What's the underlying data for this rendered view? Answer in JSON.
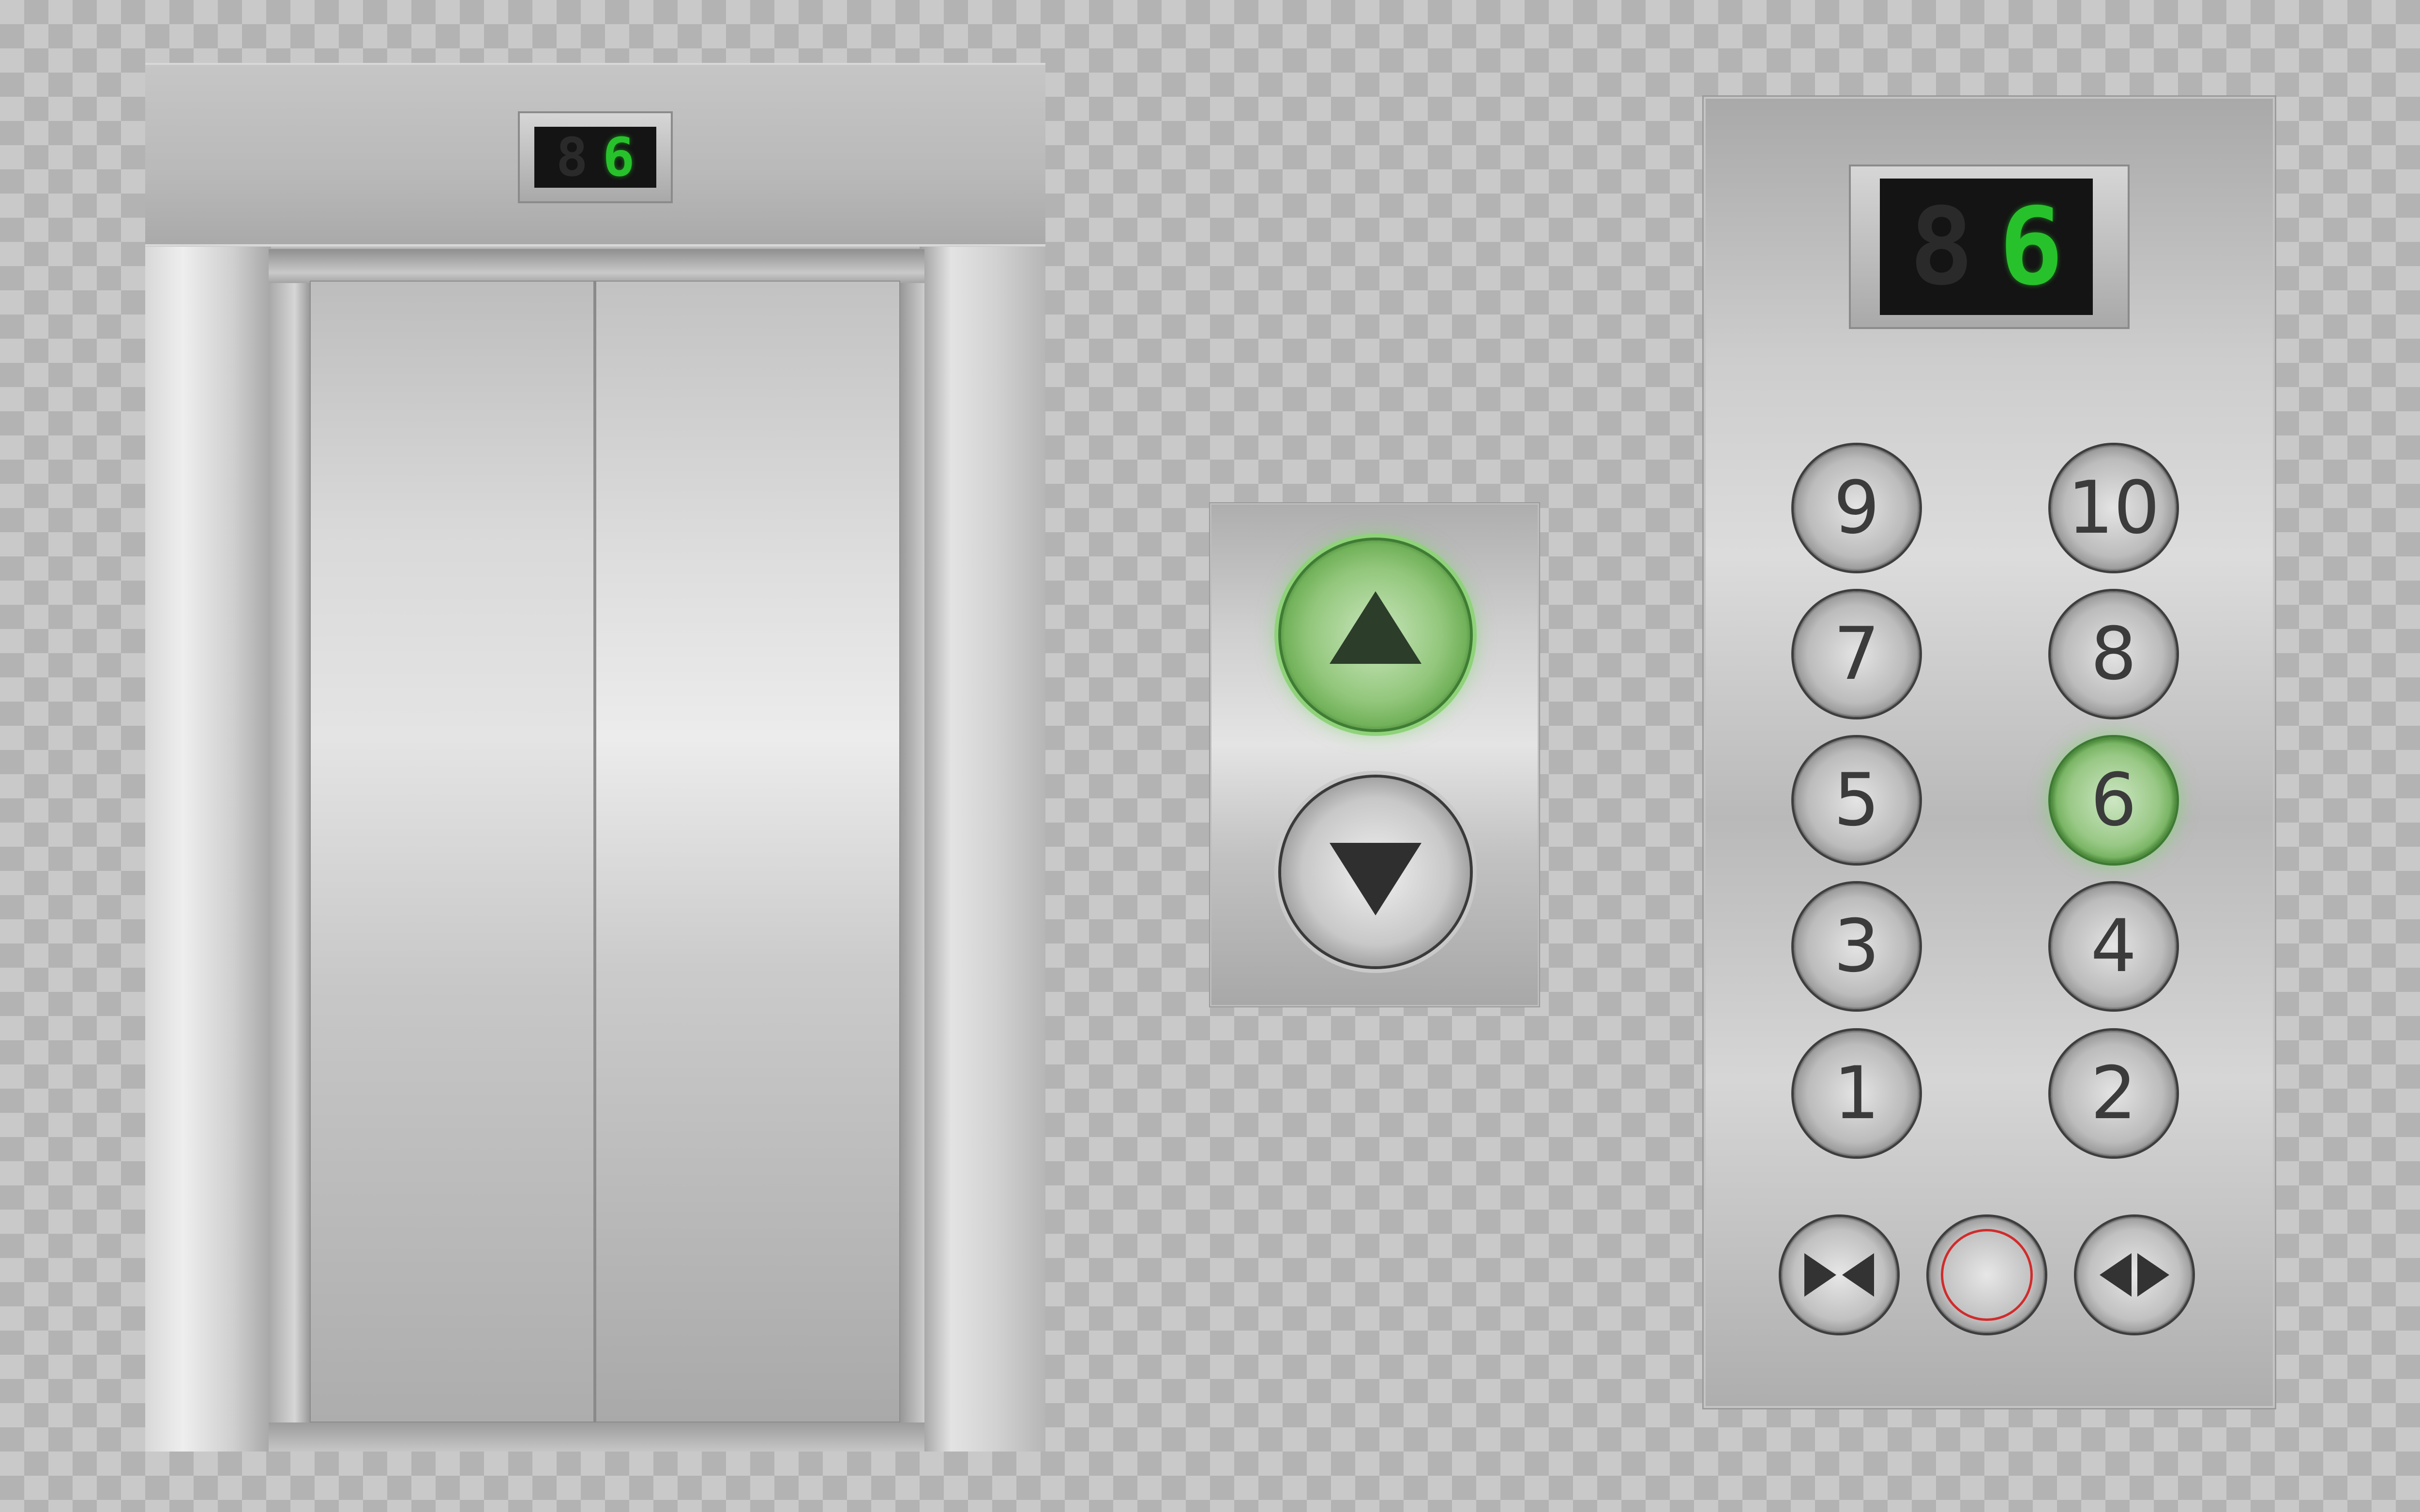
{
  "door_unit": {
    "display": {
      "dim_digit": "8",
      "lit_digit": "6"
    }
  },
  "call_panel": {
    "up": {
      "icon": "arrow-up-icon",
      "state": "lit"
    },
    "down": {
      "icon": "arrow-down-icon",
      "state": "off"
    }
  },
  "car_panel": {
    "display": {
      "dim_digit": "8",
      "lit_digit": "6"
    },
    "floor_buttons": [
      "9",
      "10",
      "7",
      "8",
      "5",
      "6",
      "3",
      "4",
      "1",
      "2"
    ],
    "lit_floor": "6",
    "function_buttons": [
      {
        "icon": "door-close-icon"
      },
      {
        "icon": "alarm-icon"
      },
      {
        "icon": "door-open-icon"
      }
    ]
  },
  "colors": {
    "lit_green": "#27c22b",
    "alarm_red": "#d12b2b"
  }
}
